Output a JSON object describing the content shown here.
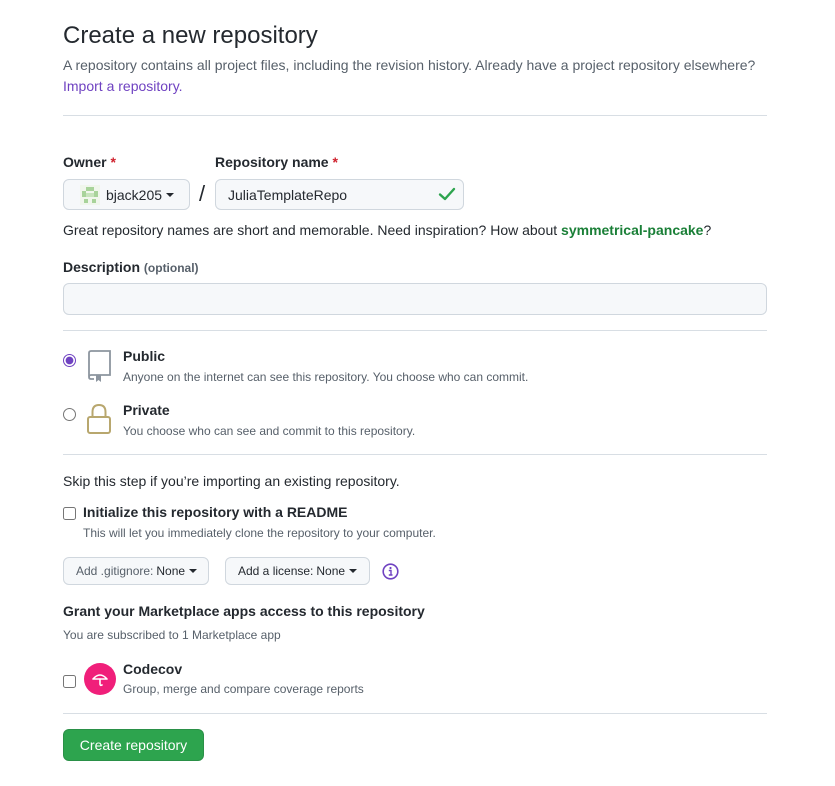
{
  "header": {
    "title": "Create a new repository",
    "subtitle": "A repository contains all project files, including the revision history. Already have a project repository elsewhere?",
    "import_link": "Import a repository."
  },
  "owner": {
    "label": "Owner",
    "required_mark": "*",
    "value": "bjack205",
    "avatar_icon": "identicon-avatar"
  },
  "slash": "/",
  "repo_name": {
    "label": "Repository name",
    "required_mark": "*",
    "value": "JuliaTemplateRepo",
    "valid_icon": "check-icon"
  },
  "name_hint": {
    "prefix": "Great repository names are short and memorable. Need inspiration? How about ",
    "suggestion": "symmetrical-pancake",
    "suffix": "?"
  },
  "description": {
    "label": "Description",
    "optional": "(optional)",
    "value": ""
  },
  "visibility": {
    "selected": "public",
    "public": {
      "title": "Public",
      "desc": "Anyone on the internet can see this repository. You choose who can commit.",
      "icon": "repo-book-icon"
    },
    "private": {
      "title": "Private",
      "desc": "You choose who can see and commit to this repository.",
      "icon": "lock-icon"
    }
  },
  "init": {
    "skip_text": "Skip this step if you’re importing an existing repository.",
    "readme_label": "Initialize this repository with a README",
    "readme_desc": "This will let you immediately clone the repository to your computer.",
    "readme_checked": false
  },
  "selectors": {
    "gitignore_label": "Add .gitignore:",
    "gitignore_value": "None",
    "license_label": "Add a license:",
    "license_value": "None",
    "info_icon": "info-icon"
  },
  "marketplace": {
    "heading": "Grant your Marketplace apps access to this repository",
    "subscribed": "You are subscribed to 1 Marketplace app",
    "apps": [
      {
        "name": "Codecov",
        "desc": "Group, merge and compare coverage reports",
        "checked": false,
        "icon": "codecov-umbrella-icon"
      }
    ]
  },
  "submit": {
    "label": "Create repository"
  },
  "colors": {
    "link": "#6f42c1",
    "success": "#2da44e",
    "required": "#cf222e",
    "suggestion": "#1a7f37",
    "codecov": "#f01f7a"
  }
}
